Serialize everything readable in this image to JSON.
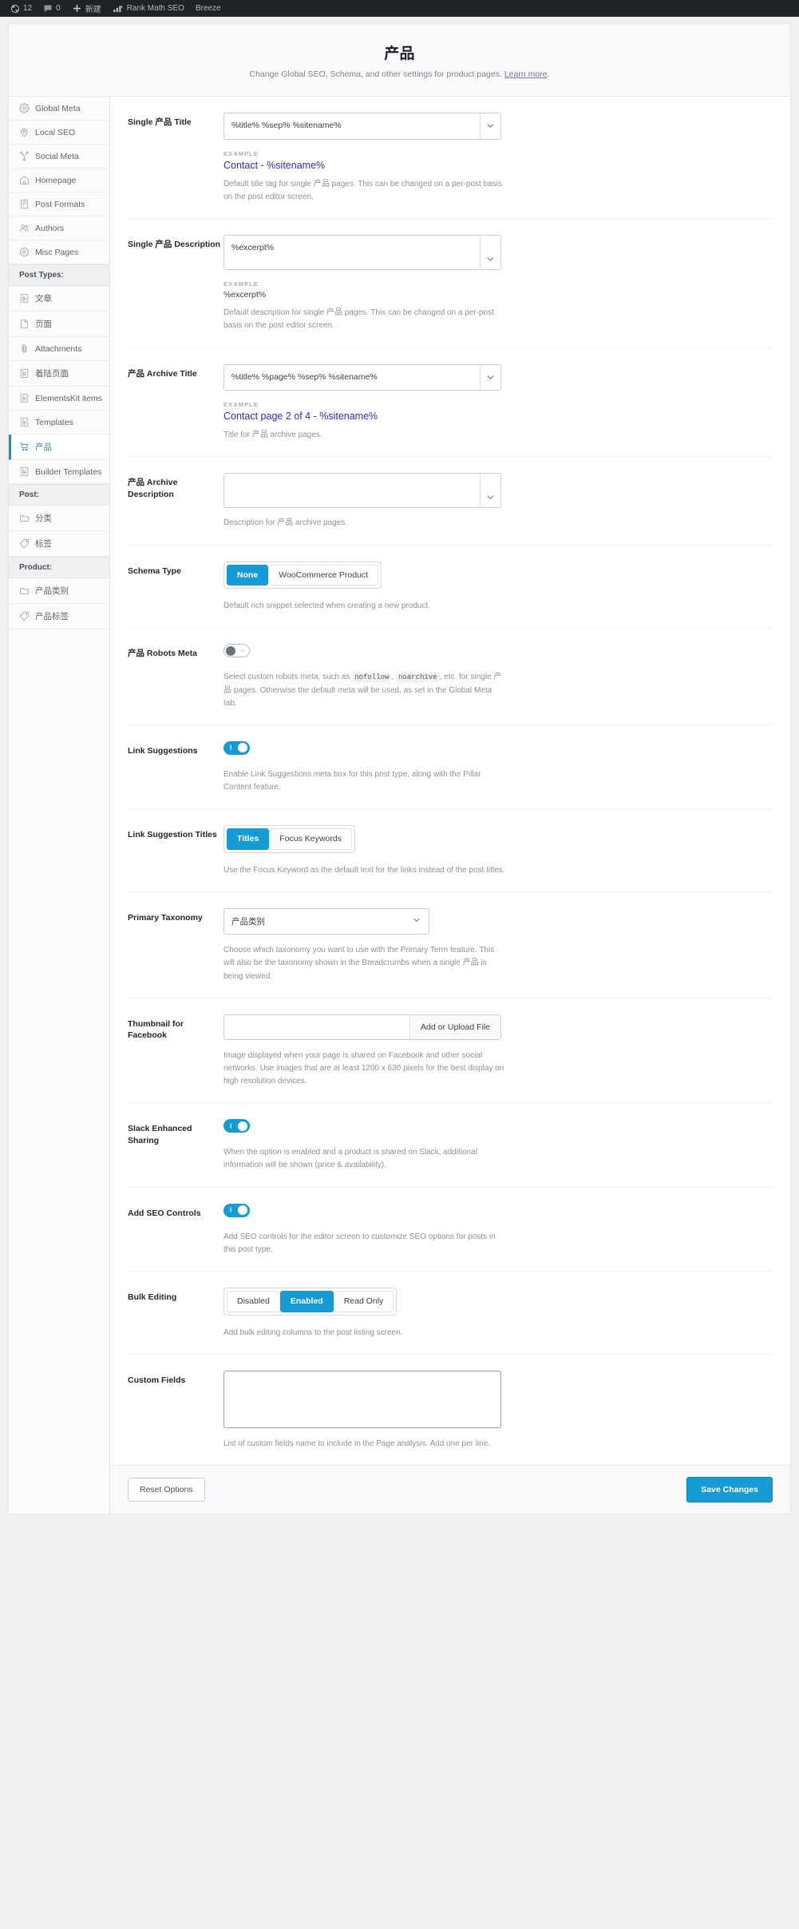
{
  "adminbar": {
    "items": [
      {
        "icon": "wordpress-updates-icon",
        "label": "12",
        "name": "updates"
      },
      {
        "icon": "comment-bubble-icon",
        "label": "0",
        "name": "comments"
      },
      {
        "icon": "plus-icon",
        "label": "新建",
        "name": "new-content"
      },
      {
        "icon": "rank-math-icon",
        "label": "Rank Math SEO",
        "name": "rank-math"
      },
      {
        "icon": "",
        "label": "Breeze",
        "name": "breeze"
      }
    ]
  },
  "header": {
    "title": "产品",
    "subtitle_before": "Change Global SEO, Schema, and other settings for product pages. ",
    "subtitle_link": "Learn more",
    "subtitle_after": "."
  },
  "sidebar": {
    "items": [
      {
        "type": "item",
        "icon": "gear-icon",
        "label": "Global Meta",
        "active": false
      },
      {
        "type": "item",
        "icon": "map-pin-icon",
        "label": "Local SEO",
        "active": false
      },
      {
        "type": "item",
        "icon": "share-nodes-icon",
        "label": "Social Meta",
        "active": false
      },
      {
        "type": "item",
        "icon": "home-icon",
        "label": "Homepage",
        "active": false
      },
      {
        "type": "item",
        "icon": "document-icon",
        "label": "Post Formats",
        "active": false
      },
      {
        "type": "item",
        "icon": "users-icon",
        "label": "Authors",
        "active": false
      },
      {
        "type": "item",
        "icon": "list-circle-icon",
        "label": "Misc Pages",
        "active": false
      },
      {
        "type": "group",
        "label": "Post Types:"
      },
      {
        "type": "item",
        "icon": "post-icon",
        "label": "文章",
        "active": false
      },
      {
        "type": "item",
        "icon": "page-icon",
        "label": "页面",
        "active": false
      },
      {
        "type": "item",
        "icon": "paperclip-icon",
        "label": "Attachments",
        "active": false
      },
      {
        "type": "item",
        "icon": "post-icon",
        "label": "着陆页面",
        "active": false
      },
      {
        "type": "item",
        "icon": "post-icon",
        "label": "ElementsKit items",
        "active": false
      },
      {
        "type": "item",
        "icon": "post-icon",
        "label": "Templates",
        "active": false
      },
      {
        "type": "item",
        "icon": "cart-icon",
        "label": "产品",
        "active": true
      },
      {
        "type": "item",
        "icon": "post-icon",
        "label": "Builder Templates",
        "active": false
      },
      {
        "type": "group",
        "label": "Post:"
      },
      {
        "type": "item",
        "icon": "folder-icon",
        "label": "分类",
        "active": false
      },
      {
        "type": "item",
        "icon": "tag-icon",
        "label": "标签",
        "active": false
      },
      {
        "type": "group",
        "label": "Product:"
      },
      {
        "type": "item",
        "icon": "folder-icon",
        "label": "产品类别",
        "active": false
      },
      {
        "type": "item",
        "icon": "tag-icon",
        "label": "产品标签",
        "active": false
      }
    ]
  },
  "fields": {
    "single_title": {
      "label": "Single 产品 Title",
      "value": "%title% %sep% %sitename%",
      "example_label": "EXAMPLE",
      "example_value": "Contact - %sitename%",
      "desc": "Default title tag for single 产品 pages. This can be changed on a per-post basis on the post editor screen."
    },
    "single_description": {
      "label": "Single 产品 Description",
      "value": "%excerpt%",
      "example_label": "EXAMPLE",
      "example_value": "%excerpt%",
      "desc": "Default description for single 产品 pages. This can be changed on a per-post basis on the post editor screen."
    },
    "archive_title": {
      "label": "产品 Archive Title",
      "value": "%title% %page% %sep% %sitename%",
      "example_label": "EXAMPLE",
      "example_value": "Contact page 2 of 4 - %sitename%",
      "desc": "Title for 产品 archive pages."
    },
    "archive_description": {
      "label": "产品 Archive Description",
      "value": "",
      "desc": "Description for 产品 archive pages."
    },
    "schema_type": {
      "label": "Schema Type",
      "options": [
        "None",
        "WooCommerce Product"
      ],
      "selected": "None",
      "desc": "Default rich snippet selected when creating a new product."
    },
    "robots_meta": {
      "label": "产品 Robots Meta",
      "toggle": "off",
      "desc_1": "Select custom robots meta, such as ",
      "code_1": "nofollow",
      "desc_2": ", ",
      "code_2": "noarchive",
      "desc_3": ", etc. for single 产品 pages. Otherwise the default meta will be used, as set in the Global Meta tab."
    },
    "link_suggestions": {
      "label": "Link Suggestions",
      "toggle": "on",
      "desc": "Enable Link Suggestions meta box for this post type, along with the Pillar Content feature."
    },
    "link_suggestion_titles": {
      "label": "Link Suggestion Titles",
      "options": [
        "Titles",
        "Focus Keywords"
      ],
      "selected": "Titles",
      "desc": "Use the Focus Keyword as the default text for the links instead of the post titles."
    },
    "primary_taxonomy": {
      "label": "Primary Taxonomy",
      "selected": "产品类别",
      "desc": "Choose which taxonomy you want to use with the Primary Term feature. This will also be the taxonomy shown in the Breadcrumbs when a single 产品 is being viewed."
    },
    "thumbnail_facebook": {
      "label": "Thumbnail for Facebook",
      "value": "",
      "button": "Add or Upload File",
      "desc": "Image displayed when your page is shared on Facebook and other social networks. Use images that are at least 1200 x 630 pixels for the best display on high resolution devices."
    },
    "slack_sharing": {
      "label": "Slack Enhanced Sharing",
      "toggle": "on",
      "desc": "When the option is enabled and a product is shared on Slack, additional information will be shown (price & availability)."
    },
    "seo_controls": {
      "label": "Add SEO Controls",
      "toggle": "on",
      "desc": "Add SEO controls for the editor screen to customize SEO options for posts in this post type."
    },
    "bulk_editing": {
      "label": "Bulk Editing",
      "options": [
        "Disabled",
        "Enabled",
        "Read Only"
      ],
      "selected": "Enabled",
      "desc": "Add bulk editing columns to the post listing screen."
    },
    "custom_fields": {
      "label": "Custom Fields",
      "value": "",
      "desc": "List of custom fields name to include in the Page analysis. Add one per line."
    }
  },
  "footer": {
    "reset_label": "Reset Options",
    "save_label": "Save Changes"
  },
  "colors": {
    "accent": "#169bd5",
    "adminbar": "#1d2327",
    "example_text": "#2b2bd6"
  }
}
